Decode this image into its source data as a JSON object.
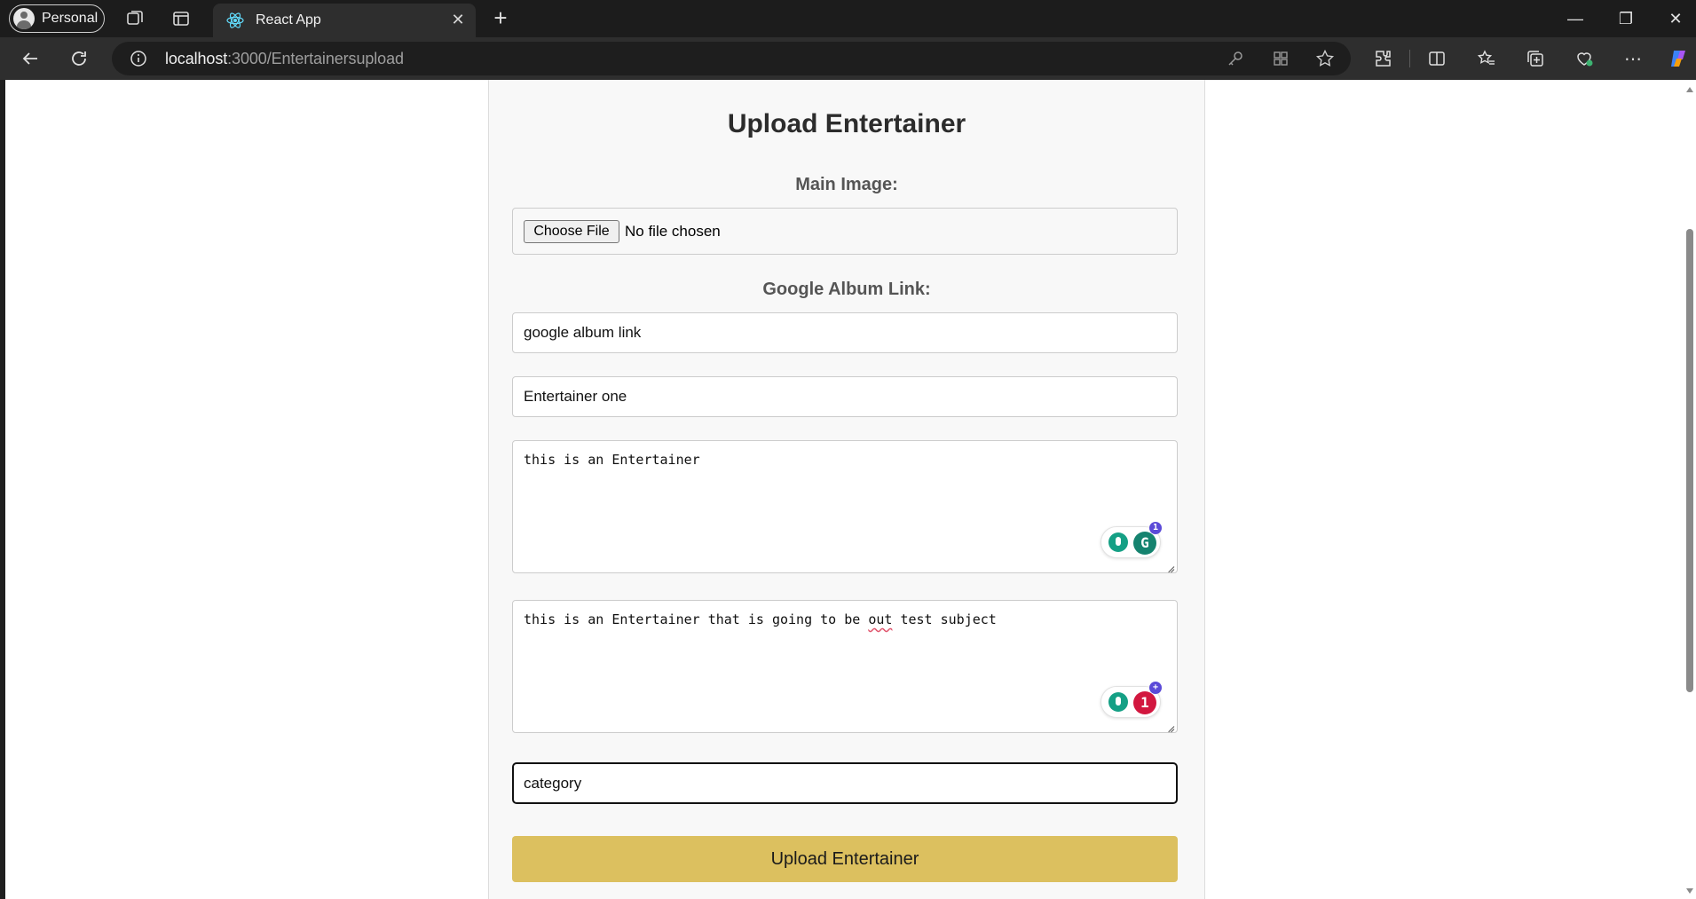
{
  "browser": {
    "profile_label": "Personal",
    "tab_title": "React App",
    "url_host": "localhost",
    "url_path": ":3000/Entertainersupload"
  },
  "form": {
    "title": "Upload Entertainer",
    "main_image_label": "Main Image:",
    "choose_file_label": "Choose File",
    "no_file_text": "No file chosen",
    "album_label": "Google Album Link:",
    "album_value": "google album link",
    "name_value": "Entertainer one",
    "short_desc_value": "this is an Entertainer",
    "long_desc_before": "this is an Entertainer that is going to be ",
    "long_desc_misspelled": "out",
    "long_desc_after": " test subject",
    "category_value": "category",
    "submit_label": "Upload Entertainer"
  },
  "grammarly": {
    "first_badge_count": "1",
    "second_badge_count": "1",
    "second_badge_extra": "+",
    "first_badge_color": "#15836f",
    "second_badge_color": "#d2173f"
  },
  "colors": {
    "accent_button": "#dcc05f",
    "card_bg": "#f8f8f8"
  }
}
